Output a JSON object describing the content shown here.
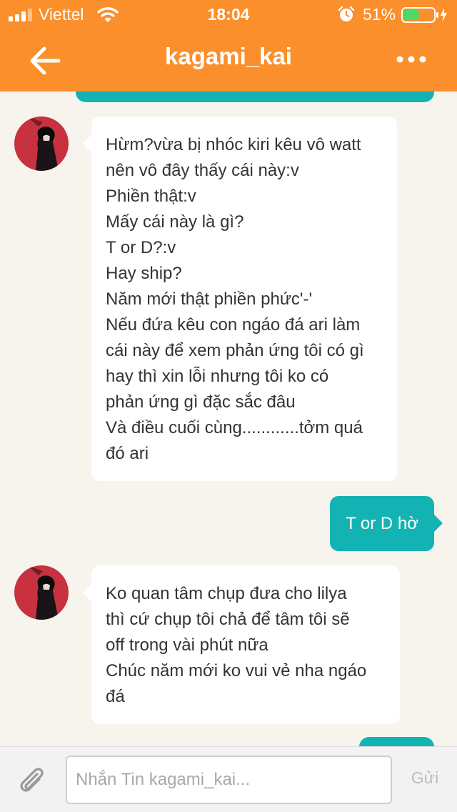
{
  "status_bar": {
    "carrier": "Viettel",
    "time": "18:04",
    "battery_percent": "51%",
    "battery_level": 0.51,
    "icons": [
      "signal-icon",
      "wifi-icon",
      "alarm-icon",
      "battery-icon",
      "charging-icon"
    ]
  },
  "header": {
    "title": "kagami_kai",
    "back_icon": "arrow-left-icon",
    "more_icon": "more-dots-icon"
  },
  "messages": [
    {
      "direction": "incoming",
      "text": "Hừm?vừa bị nhóc kiri kêu vô watt\nnên vô đây thấy cái này:v\nPhiền thật:v\nMấy cái này là gì?\nT or D?:v\nHay ship?\nNăm mới thật phiền phức'-'\nNếu đứa kêu con ngáo đá ari làm\ncái này để xem phản ứng tôi có gì\nhay thì xin lỗi nhưng tôi ko có\nphản ứng gì đặc sắc đâu\nVà điều cuối cùng............tởm quá\nđó ari"
    },
    {
      "direction": "outgoing",
      "text": "T or D hờ"
    },
    {
      "direction": "incoming",
      "text": "Ko quan tâm chụp đưa cho lilya\nthì cứ chụp tôi chả để tâm tôi sẽ\noff trong vài phút nữa\nChúc năm mới ko vui vẻ nha ngáo\nđá"
    }
  ],
  "composer": {
    "placeholder": "Nhắn Tin kagami_kai...",
    "value": "",
    "send_label": "Gửi",
    "attach_icon": "paperclip-icon"
  },
  "colors": {
    "header_orange": "#fb8f2b",
    "outgoing_teal": "#14b3b3",
    "chat_background": "#f7f4ee",
    "incoming_bubble": "#ffffff"
  }
}
